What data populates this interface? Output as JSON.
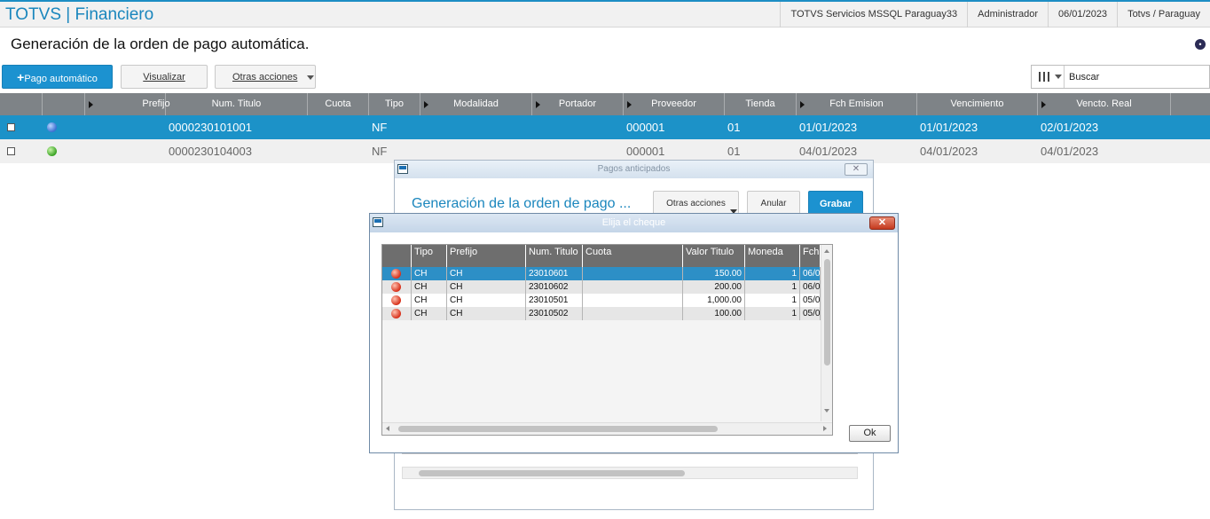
{
  "app": {
    "brand": "TOTVS | Financiero",
    "server": "TOTVS Servicios MSSQL Paraguay33",
    "user": "Administrador",
    "date": "06/01/2023",
    "company": "Totvs / Paraguay"
  },
  "page": {
    "title": "Generación de la orden de pago automática."
  },
  "toolbar": {
    "pago_automatico": "Pago automático",
    "visualizar": "Visualizar",
    "otras_acciones": "Otras acciones",
    "search_value": "Buscar"
  },
  "grid": {
    "headers": [
      "Prefijo",
      "Num. Titulo",
      "Cuota",
      "Tipo",
      "Modalidad",
      "Portador",
      "Proveedor",
      "Tienda",
      "Fch Emision",
      "Vencimiento",
      "Vencto. Real"
    ],
    "rows": [
      {
        "status": "blue",
        "num_titulo": "0000230101001",
        "tipo": "NF",
        "proveedor": "000001",
        "tienda": "01",
        "fch_emision": "01/01/2023",
        "vencimiento": "01/01/2023",
        "vencto_real": "02/01/2023"
      },
      {
        "status": "green",
        "num_titulo": "0000230104003",
        "tipo": "NF",
        "proveedor": "000001",
        "tienda": "01",
        "fch_emision": "04/01/2023",
        "vencimiento": "04/01/2023",
        "vencto_real": "04/01/2023"
      }
    ]
  },
  "dialog_pagos": {
    "title": "Pagos anticipados",
    "heading": "Generación de la orden de pago ...",
    "otras_acciones": "Otras acciones",
    "anular": "Anular",
    "grabar": "Grabar"
  },
  "dialog_cheque": {
    "title": "Elija el cheque",
    "headers": [
      "Tipo",
      "Prefijo",
      "Num. Titulo",
      "Cuota",
      "Valor Titulo",
      "Moneda",
      "Fch"
    ],
    "rows": [
      {
        "tipo": "CH",
        "prefijo": "CH",
        "num_titulo": "23010601",
        "cuota": "",
        "valor": "150.00",
        "moneda": "1",
        "fch": "06/0"
      },
      {
        "tipo": "CH",
        "prefijo": "CH",
        "num_titulo": "23010602",
        "cuota": "",
        "valor": "200.00",
        "moneda": "1",
        "fch": "06/0"
      },
      {
        "tipo": "CH",
        "prefijo": "CH",
        "num_titulo": "23010501",
        "cuota": "",
        "valor": "1,000.00",
        "moneda": "1",
        "fch": "05/0"
      },
      {
        "tipo": "CH",
        "prefijo": "CH",
        "num_titulo": "23010502",
        "cuota": "",
        "valor": "100.00",
        "moneda": "1",
        "fch": "05/0"
      }
    ],
    "ok": "Ok"
  },
  "icons": [
    "plus-icon",
    "caret-down-icon",
    "columns-icon",
    "window-icon",
    "close-icon",
    "status-dot-icon",
    "sort-arrow-icon"
  ],
  "colors": {
    "accent": "#1c92d0",
    "header_gray": "#7e8387",
    "selected_row": "#1c92c8"
  }
}
